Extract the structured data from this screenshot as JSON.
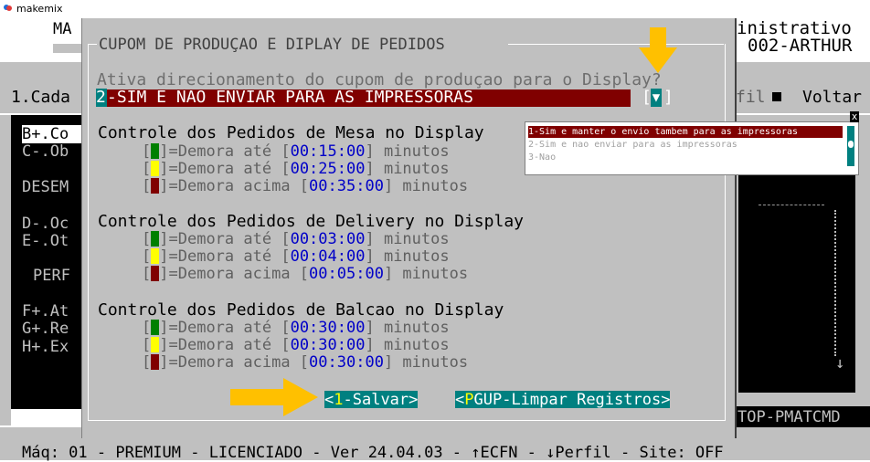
{
  "window": {
    "title": "makemix"
  },
  "background": {
    "top_left": "MA",
    "top_right_1": "inistrativo",
    "top_right_2": "002-ARTHUR",
    "menu_left": "1.Cada",
    "menu_right_fil": "fil",
    "menu_right_voltar": "Voltar",
    "side_items": [
      "B+.Co",
      "C-.Ob",
      "DESEM",
      "D-.Oc",
      "E-.Ot",
      "PERF",
      "F+.At",
      "G+.Re",
      "H+.Ex"
    ],
    "right_label": "TOP-PMATCMD",
    "status_line": "Máq: 01 - PREMIUM - LICENCIADO - Ver 24.04.03 - ↑ECFN - ↓Perfil - Site: OFF"
  },
  "dialog": {
    "title": "CUPOM DE PRODUÇAO E DIPLAY DE PEDIDOS",
    "question": "Ativa direcionamento do cupom de produçao para o Display?",
    "selected_index": "2",
    "selected_text": "-SIM E NAO ENVIAR PARA AS IMPRESSORAS",
    "dropdown_button": "▼",
    "sections": [
      {
        "title": "Controle dos Pedidos de Mesa no Display",
        "rows": [
          {
            "label": "=Demora até ",
            "time": "00:15:00",
            "suffix": " minutos"
          },
          {
            "label": "=Demora até ",
            "time": "00:25:00",
            "suffix": " minutos"
          },
          {
            "label": "=Demora acima ",
            "time": "00:35:00",
            "suffix": " minutos"
          }
        ]
      },
      {
        "title": "Controle dos Pedidos de Delivery no Display",
        "rows": [
          {
            "label": "=Demora até ",
            "time": "00:03:00",
            "suffix": " minutos"
          },
          {
            "label": "=Demora até ",
            "time": "00:04:00",
            "suffix": " minutos"
          },
          {
            "label": "=Demora acima ",
            "time": "00:05:00",
            "suffix": " minutos"
          }
        ]
      },
      {
        "title": "Controle dos Pedidos de Balcao no Display",
        "rows": [
          {
            "label": "=Demora até ",
            "time": "00:30:00",
            "suffix": " minutos"
          },
          {
            "label": "=Demora até ",
            "time": "00:30:00",
            "suffix": " minutos"
          },
          {
            "label": "=Demora acima ",
            "time": "00:30:00",
            "suffix": " minutos"
          }
        ]
      }
    ],
    "buttons": {
      "save_key": "1",
      "save_label": "-Salvar>",
      "clear_key": "P",
      "clear_label": "GUP-Limpar Registros>"
    }
  },
  "dropdown": {
    "close": "x",
    "options": [
      "1-Sim e manter o envio tambem para as impressoras",
      "2-Sim e nao enviar para as impressoras",
      "3-Nao"
    ]
  },
  "colors": {
    "selection_bg": "#800000",
    "swatch_green": "#008000",
    "swatch_yellow": "#ffff00",
    "swatch_red": "#800000",
    "button_bg": "#008080",
    "arrow": "#ffc000"
  }
}
